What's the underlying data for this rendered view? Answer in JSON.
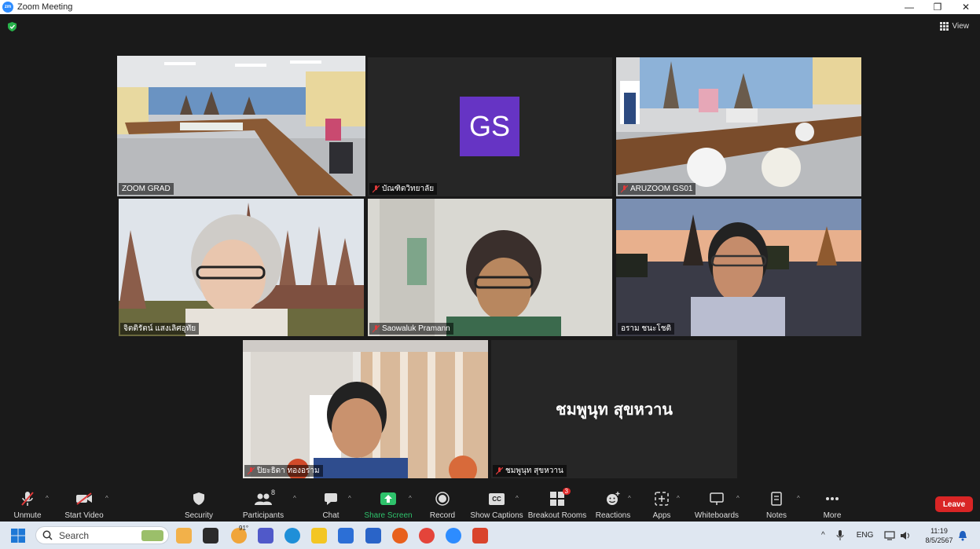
{
  "window": {
    "title": "Zoom Meeting",
    "logo_text": "zm",
    "minimize": "—",
    "restore": "❐",
    "close": "✕"
  },
  "view_label": "View",
  "tiles": {
    "t1": {
      "name": "ZOOM GRAD"
    },
    "t2": {
      "name": "บัณฑิตวิทยาลัย",
      "initials": "GS"
    },
    "t3": {
      "name": "ARUZOOM GS01"
    },
    "t4": {
      "name": "จิตติรัตน์ แสงเลิศอุทัย"
    },
    "t5": {
      "name": "Saowaluk Pramann"
    },
    "t6": {
      "name": "อราม ชนะโชติ"
    },
    "t7": {
      "name": "ปิยะธิดา ทองอร่าม"
    },
    "t8": {
      "name": "ชมพูนุท  สุขหวาน",
      "big_name": "ชมพูนุท  สุขหวาน"
    }
  },
  "toolbar": {
    "unmute": "Unmute",
    "start_video": "Start Video",
    "security": "Security",
    "participants": "Participants",
    "participants_count": "8",
    "chat": "Chat",
    "share_screen": "Share Screen",
    "record": "Record",
    "show_captions": "Show Captions",
    "captions_icon_text": "CC",
    "breakout_rooms": "Breakout Rooms",
    "breakout_badge": "3",
    "reactions": "Reactions",
    "apps": "Apps",
    "whiteboards": "Whiteboards",
    "notes": "Notes",
    "more": "More",
    "leave": "Leave"
  },
  "taskbar": {
    "search_placeholder": "Search",
    "weather_temp": "91°",
    "language": "ENG",
    "time": "11:19",
    "date": "8/5/2567"
  },
  "colors": {
    "active_border": "#e6e06a",
    "avatar": "#6634c4",
    "leave": "#d92525",
    "share_green": "#2ec26b"
  }
}
